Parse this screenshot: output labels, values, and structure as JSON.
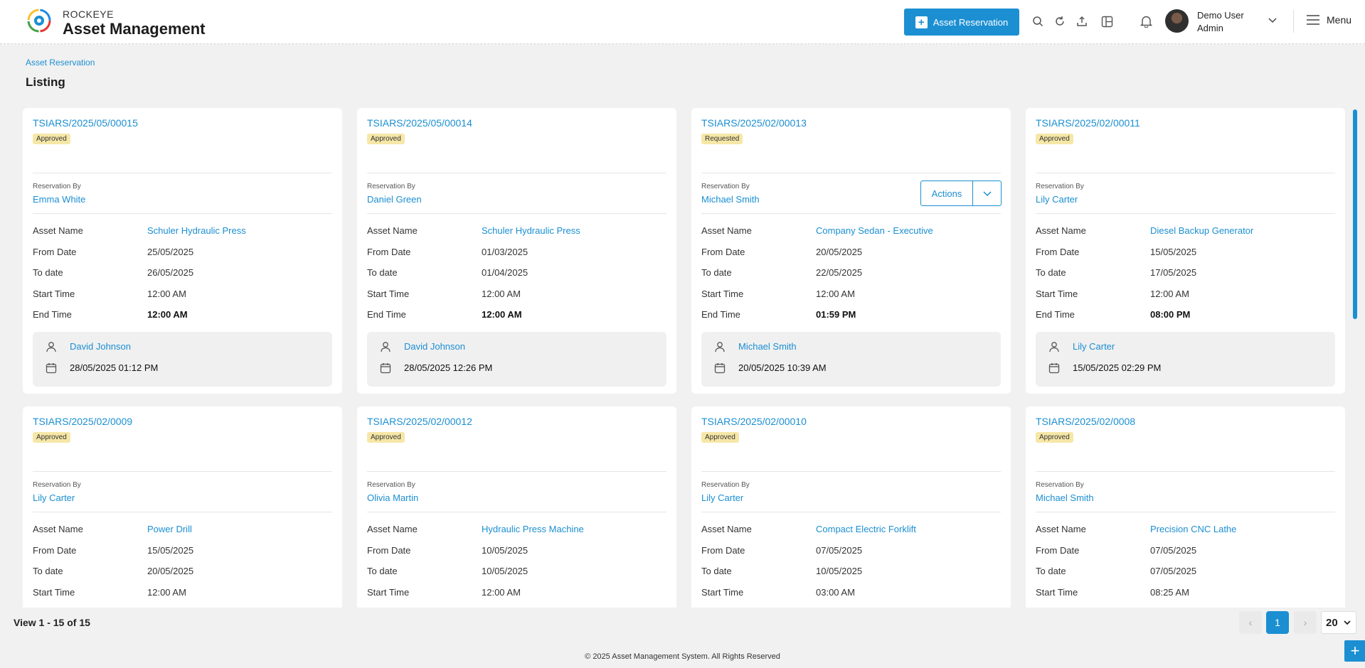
{
  "header": {
    "brand_top": "ROCKEYE",
    "brand_main": "Asset Management",
    "reserve_button": "Asset Reservation",
    "user_name": "Demo User",
    "user_role": "Admin",
    "menu_label": "Menu"
  },
  "breadcrumb": "Asset Reservation",
  "page_title": "Listing",
  "labels": {
    "reservation_by": "Reservation By",
    "asset_name": "Asset Name",
    "from_date": "From Date",
    "to_date": "To date",
    "start_time": "Start Time",
    "end_time": "End Time",
    "actions": "Actions"
  },
  "cards": [
    {
      "code": "TSIARS/2025/05/00015",
      "status": "Approved",
      "reservation_by": "Emma White",
      "asset_name": "Schuler Hydraulic Press",
      "from_date": "25/05/2025",
      "to_date": "26/05/2025",
      "start_time": "12:00 AM",
      "end_time": "12:00 AM",
      "created_by": "David Johnson",
      "created_at": "28/05/2025 01:12 PM"
    },
    {
      "code": "TSIARS/2025/05/00014",
      "status": "Approved",
      "reservation_by": "Daniel Green",
      "asset_name": "Schuler Hydraulic Press",
      "from_date": "01/03/2025",
      "to_date": "01/04/2025",
      "start_time": "12:00 AM",
      "end_time": "12:00 AM",
      "created_by": "David Johnson",
      "created_at": "28/05/2025 12:26 PM"
    },
    {
      "code": "TSIARS/2025/02/00013",
      "status": "Requested",
      "reservation_by": "Michael Smith",
      "asset_name": "Company Sedan - Executive",
      "from_date": "20/05/2025",
      "to_date": "22/05/2025",
      "start_time": "12:00 AM",
      "end_time": "01:59 PM",
      "created_by": "Michael Smith",
      "created_at": "20/05/2025 10:39 AM"
    },
    {
      "code": "TSIARS/2025/02/00011",
      "status": "Approved",
      "reservation_by": "Lily Carter",
      "asset_name": "Diesel Backup Generator",
      "from_date": "15/05/2025",
      "to_date": "17/05/2025",
      "start_time": "12:00 AM",
      "end_time": "08:00 PM",
      "created_by": "Lily Carter",
      "created_at": "15/05/2025 02:29 PM"
    },
    {
      "code": "TSIARS/2025/02/0009",
      "status": "Approved",
      "reservation_by": "Lily Carter",
      "asset_name": "Power Drill",
      "from_date": "15/05/2025",
      "to_date": "20/05/2025",
      "start_time": "12:00 AM"
    },
    {
      "code": "TSIARS/2025/02/00012",
      "status": "Approved",
      "reservation_by": "Olivia Martin",
      "asset_name": "Hydraulic Press Machine",
      "from_date": "10/05/2025",
      "to_date": "10/05/2025",
      "start_time": "12:00 AM"
    },
    {
      "code": "TSIARS/2025/02/00010",
      "status": "Approved",
      "reservation_by": "Lily Carter",
      "asset_name": "Compact Electric Forklift",
      "from_date": "07/05/2025",
      "to_date": "10/05/2025",
      "start_time": "03:00 AM"
    },
    {
      "code": "TSIARS/2025/02/0008",
      "status": "Approved",
      "reservation_by": "Michael Smith",
      "asset_name": "Precision CNC Lathe",
      "from_date": "07/05/2025",
      "to_date": "07/05/2025",
      "start_time": "08:25 AM"
    }
  ],
  "pagination": {
    "view_text": "View 1 - 15 of 15",
    "current_page": "1",
    "page_size": "20",
    "prev": "‹",
    "next": "›"
  },
  "copyright": "© 2025 Asset Management System. All Rights Reserved",
  "colors": {
    "accent": "#1b8fd2",
    "approved_badge": "#f6e7a7",
    "requested_badge": "#f6e7a7"
  }
}
